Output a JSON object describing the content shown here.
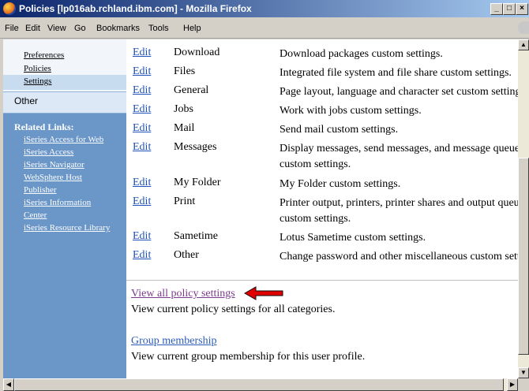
{
  "window": {
    "title": "Policies [lp016ab.rchland.ibm.com] - Mozilla Firefox"
  },
  "menu": [
    "File",
    "Edit",
    "View",
    "Go",
    "Bookmarks",
    "Tools",
    "Help"
  ],
  "sidebar": {
    "links": [
      "Preferences",
      "Policies",
      "Settings"
    ],
    "other": "Other",
    "related_heading": "Related Links:",
    "related": [
      "iSeries Access for Web",
      "iSeries Access",
      "iSeries Navigator",
      "WebSphere Host",
      "Publisher",
      "iSeries Information",
      "Center",
      "iSeries Resource Library"
    ]
  },
  "settings": [
    {
      "edit": "Edit",
      "name": "Download",
      "desc": "Download packages custom settings."
    },
    {
      "edit": "Edit",
      "name": "Files",
      "desc": "Integrated file system and file share custom settings."
    },
    {
      "edit": "Edit",
      "name": "General",
      "desc": "Page layout, language and character set custom settings."
    },
    {
      "edit": "Edit",
      "name": "Jobs",
      "desc": "Work with jobs custom settings."
    },
    {
      "edit": "Edit",
      "name": "Mail",
      "desc": "Send mail custom settings."
    },
    {
      "edit": "Edit",
      "name": "Messages",
      "desc": "Display messages, send messages, and message queue",
      "desc2": "custom settings."
    },
    {
      "edit": "Edit",
      "name": "My Folder",
      "desc": "My Folder custom settings."
    },
    {
      "edit": "Edit",
      "name": "Print",
      "desc": "Printer output, printers, printer shares and output queues",
      "desc2": "custom settings."
    },
    {
      "edit": "Edit",
      "name": "Sametime",
      "desc": "Lotus Sametime custom settings."
    },
    {
      "edit": "Edit",
      "name": "Other",
      "desc": "Change password and other miscellaneous custom settings."
    }
  ],
  "view_all": {
    "label": "View all policy settings",
    "desc": "View current policy settings for all categories."
  },
  "group": {
    "label": "Group membership",
    "desc": "View current group membership for this user profile."
  },
  "colors": {
    "sidebar": "#6a96c8",
    "link": "#1f52b8",
    "visited": "#7a3b8c",
    "arrow": "#e00000"
  }
}
